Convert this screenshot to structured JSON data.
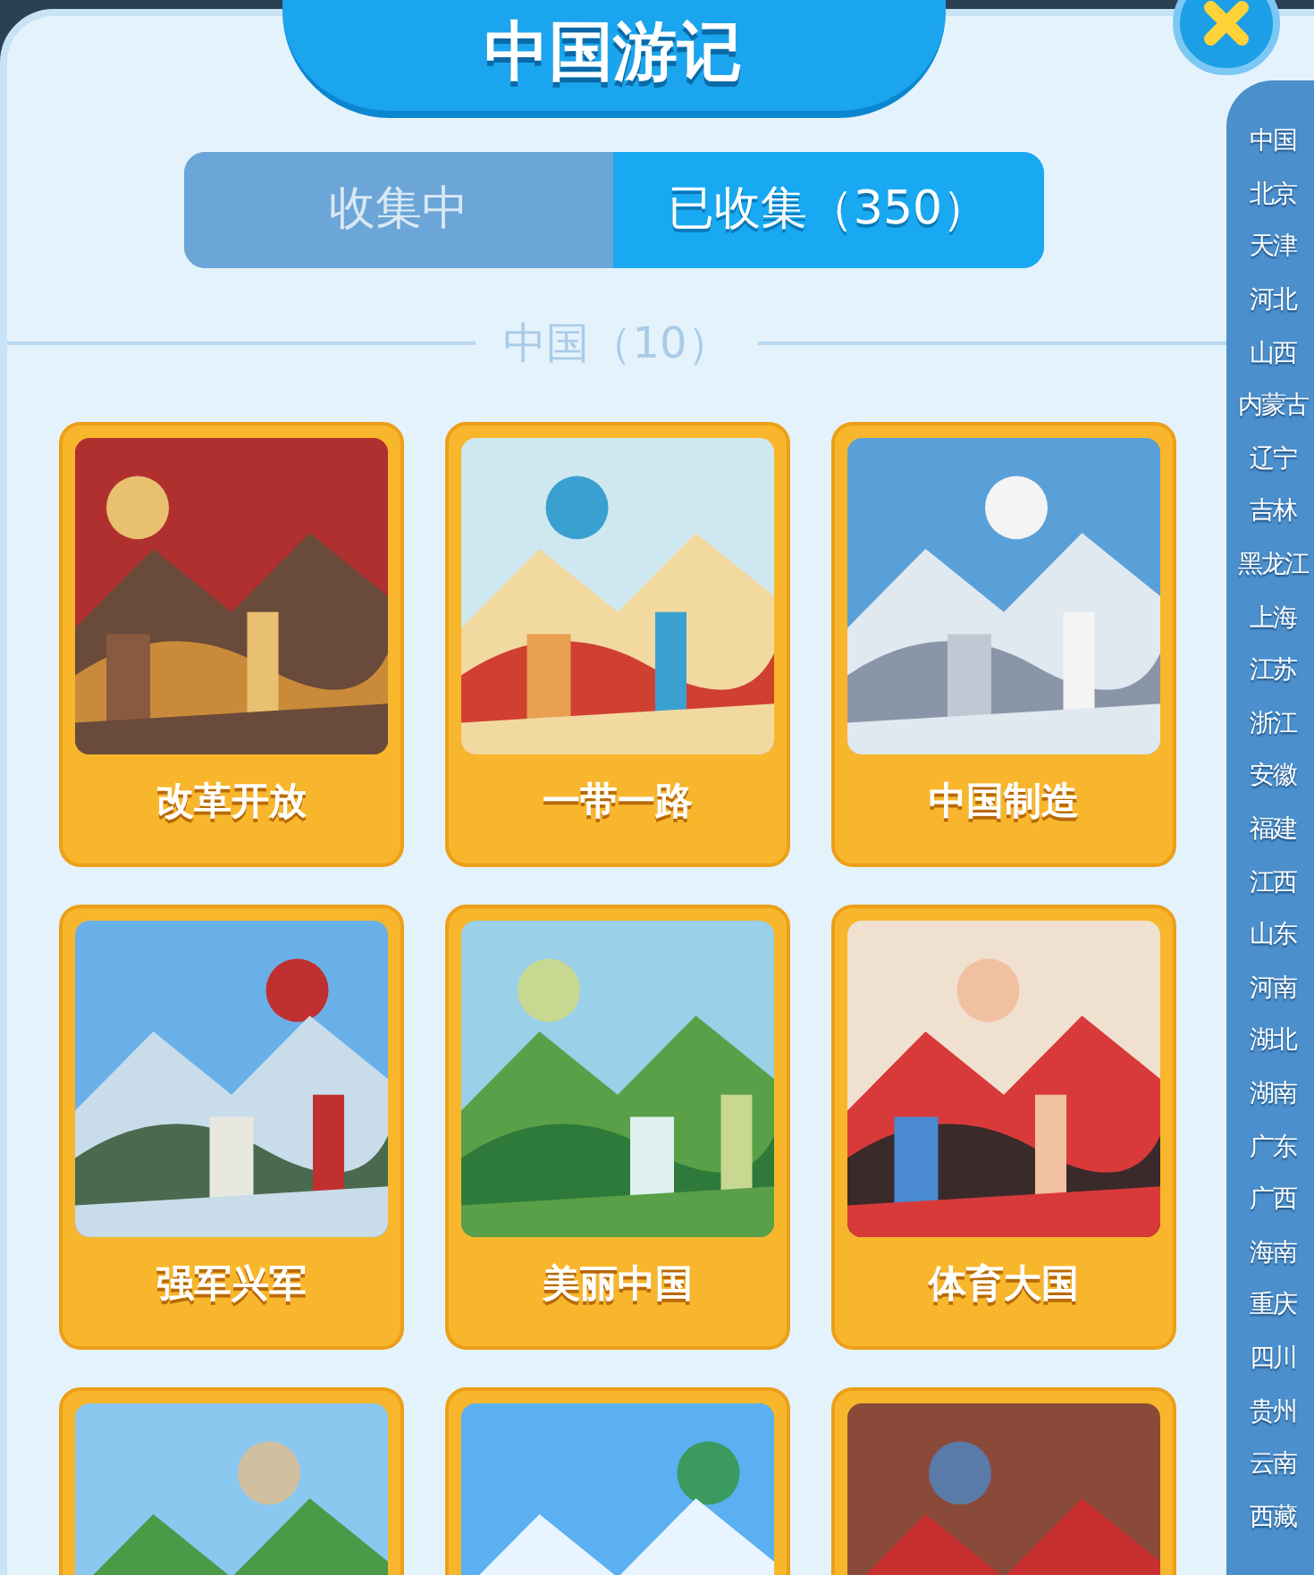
{
  "title": "中国游记",
  "tabs": [
    {
      "label": "收集中",
      "selected": false
    },
    {
      "label": "已收集（350）",
      "selected": true
    }
  ],
  "section": {
    "heading": "中国（10）"
  },
  "cards": [
    {
      "kind": "picture",
      "title": "改革开放"
    },
    {
      "kind": "picture",
      "title": "一带一路"
    },
    {
      "kind": "picture",
      "title": "中国制造"
    },
    {
      "kind": "picture",
      "title": "强军兴军"
    },
    {
      "kind": "picture",
      "title": "美丽中国"
    },
    {
      "kind": "picture",
      "title": "体育大国"
    },
    {
      "kind": "picture"
    },
    {
      "kind": "picture"
    },
    {
      "kind": "picture"
    }
  ],
  "sidebar": {
    "items": [
      "中国",
      "北京",
      "天津",
      "河北",
      "山西",
      "内蒙古",
      "辽宁",
      "吉林",
      "黑龙江",
      "上海",
      "江苏",
      "浙江",
      "安徽",
      "福建",
      "江西",
      "山东",
      "河南",
      "湖北",
      "湖南",
      "广东",
      "广西",
      "海南",
      "重庆",
      "四川",
      "贵州",
      "云南",
      "西藏"
    ]
  }
}
